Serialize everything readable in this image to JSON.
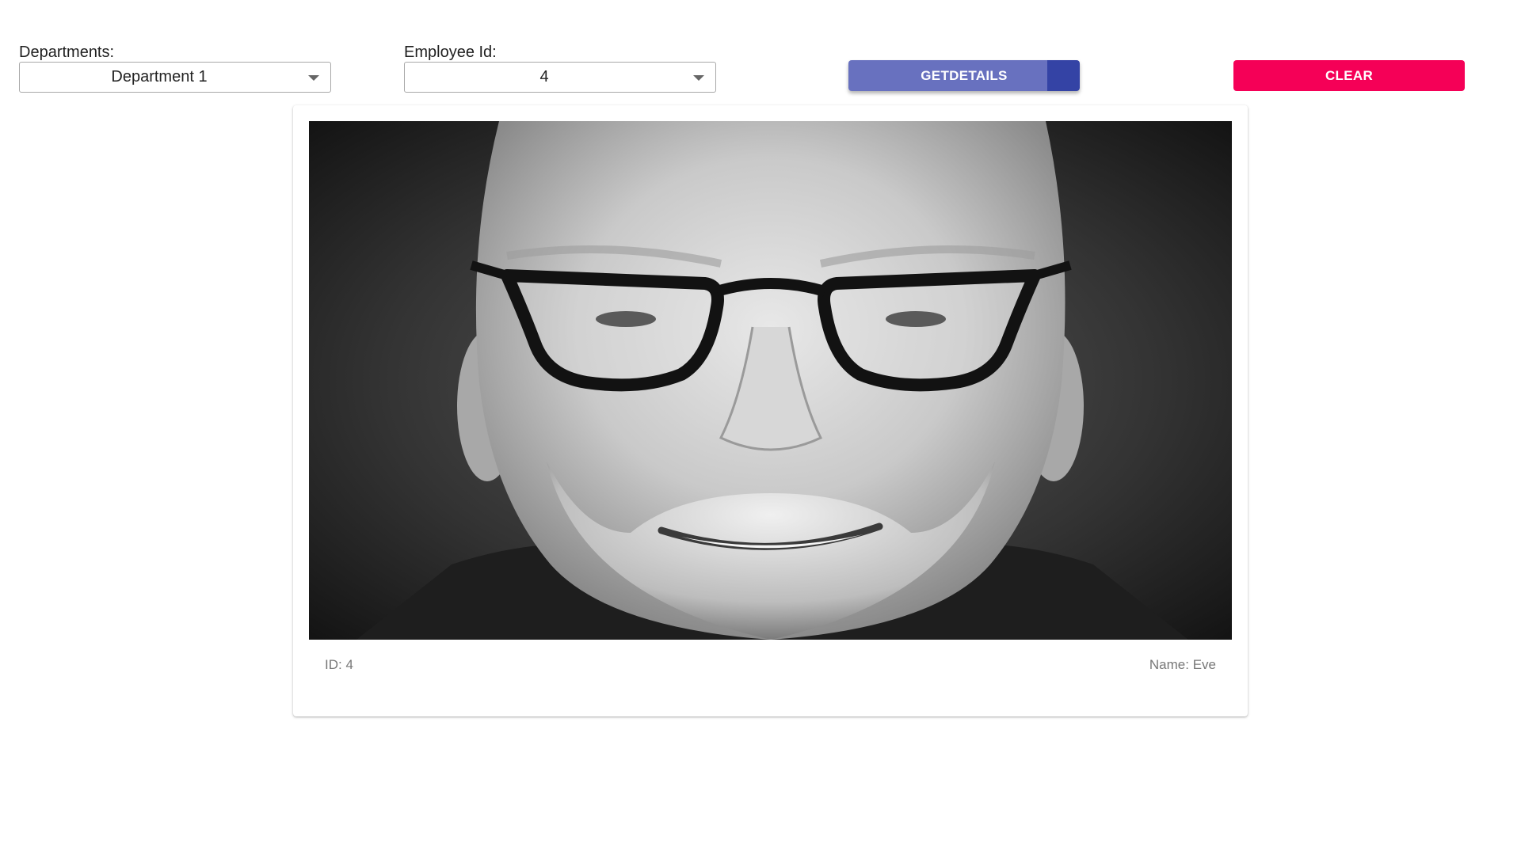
{
  "filters": {
    "departments": {
      "label": "Departments:",
      "value": "Department 1"
    },
    "employee_id": {
      "label": "Employee Id:",
      "value": "4"
    }
  },
  "actions": {
    "get_details_label": "GETDETAILS",
    "clear_label": "CLEAR"
  },
  "colors": {
    "primary": "#6871bf",
    "primary_dark": "#3443a5",
    "accent": "#f50057"
  },
  "card": {
    "photo_description": "grayscale-portrait",
    "id_text": "ID: 4",
    "name_text": "Name: Eve"
  },
  "icons": {
    "dropdown": "chevron-down-icon"
  }
}
